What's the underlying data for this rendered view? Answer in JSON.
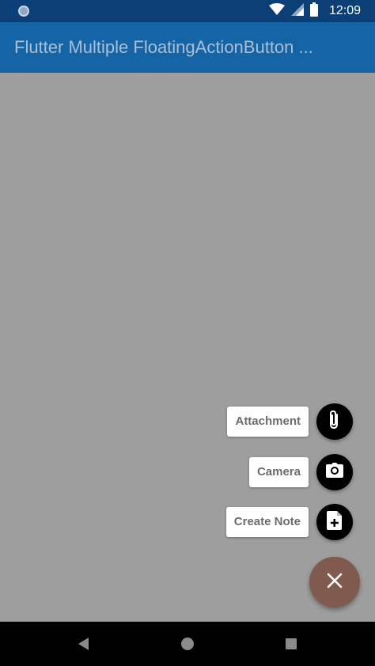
{
  "status_bar": {
    "time": "12:09",
    "icons": [
      "app-notification-icon",
      "wifi-icon",
      "signal-icon",
      "battery-icon"
    ]
  },
  "app_bar": {
    "title": "Flutter Multiple FloatingActionButton ..."
  },
  "speed_dial": {
    "actions": [
      {
        "label": "Attachment",
        "icon": "paperclip-icon"
      },
      {
        "label": "Camera",
        "icon": "camera-icon"
      },
      {
        "label": "Create Note",
        "icon": "note-add-icon"
      }
    ],
    "main_button_icon": "close-icon"
  },
  "nav_bar": {
    "buttons": [
      "back-icon",
      "home-icon",
      "recents-icon"
    ]
  },
  "colors": {
    "status_bar": "#0b3f75",
    "app_bar": "#1565a6",
    "background": "#9e9e9e",
    "mini_fab": "#000000",
    "main_fab": "#805a4e",
    "label_bg": "#ffffff"
  }
}
